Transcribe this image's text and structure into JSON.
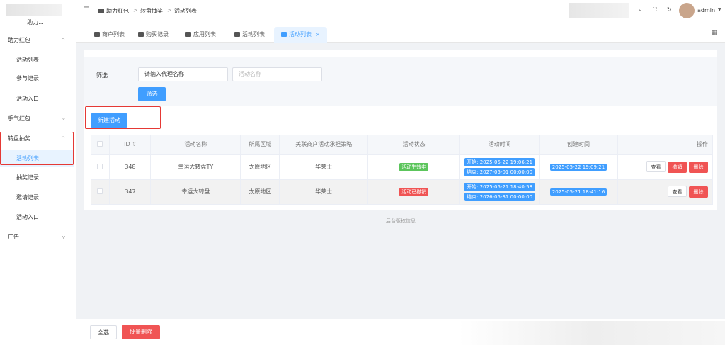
{
  "sidebar": {
    "logo_text": "助力...",
    "items": [
      {
        "label": "助力红包",
        "type": "group",
        "chev": "^"
      },
      {
        "label": "活动列表",
        "type": "sub"
      },
      {
        "label": "参与记录",
        "type": "sub"
      },
      {
        "label": "活动入口",
        "type": "sub"
      },
      {
        "label": "手气红包",
        "type": "group",
        "chev": "v"
      },
      {
        "label": "转盘抽奖",
        "type": "group",
        "chev": "^"
      },
      {
        "label": "活动列表",
        "type": "sub",
        "active": true
      },
      {
        "label": "抽奖记录",
        "type": "sub"
      },
      {
        "label": "邀请记录",
        "type": "sub"
      },
      {
        "label": "活动入口",
        "type": "sub"
      },
      {
        "label": "广告",
        "type": "group",
        "chev": "v"
      }
    ]
  },
  "header": {
    "breadcrumb": [
      "助力红包",
      "转盘抽奖",
      "活动列表"
    ],
    "sep": ">",
    "user": "admin"
  },
  "tabs": [
    {
      "label": "商户列表"
    },
    {
      "label": "购买记录"
    },
    {
      "label": "应用列表"
    },
    {
      "label": "活动列表"
    },
    {
      "label": "活动列表",
      "active": true
    }
  ],
  "filter": {
    "label": "筛选",
    "agent_value": "请输入代理名称",
    "name_placeholder": "活动名称",
    "button": "筛选"
  },
  "new_button": "新建活动",
  "table": {
    "headers": [
      "ID",
      "活动名称",
      "所属区域",
      "关联商户活动承担策略",
      "活动状态",
      "活动时间",
      "创建时间",
      "操作"
    ],
    "rows": [
      {
        "id": "348",
        "name": "幸运大转盘TY",
        "region": "太原地区",
        "strategy": "华莱士",
        "status": "活动生效中",
        "status_color": "#5cc55c",
        "start": "开始: 2025-05-22 19:06:21",
        "end": "结束: 2027-05-01 00:00:00",
        "created": "2025-05-22 19:09:21",
        "actions": [
          "查看",
          "撤销",
          "删除"
        ]
      },
      {
        "id": "347",
        "name": "幸运大转盘",
        "region": "太原地区",
        "strategy": "华莱士",
        "status": "活动已撤销",
        "status_color": "#f05454",
        "start": "开始: 2025-05-21 18:40:58",
        "end": "结束: 2026-05-31 00:00:00",
        "created": "2025-05-21 18:41:16",
        "actions": [
          "查看",
          "删除"
        ]
      }
    ]
  },
  "copyright": "后台版权信息",
  "footer": {
    "select_all": "全选",
    "batch_delete": "批量删除"
  },
  "colors": {
    "primary": "#409eff",
    "danger": "#f05454",
    "success": "#5cc55c",
    "highlight": "#e53935"
  }
}
